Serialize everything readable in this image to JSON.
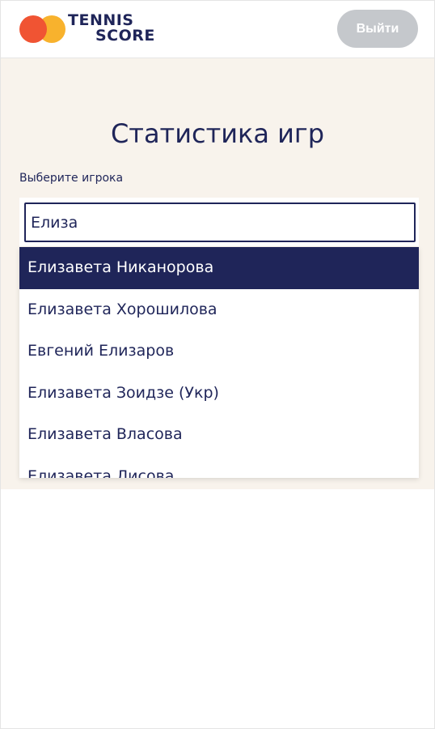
{
  "header": {
    "logo_line1": "TENNIS",
    "logo_line2": "SCORE",
    "logout_label": "Выйти"
  },
  "main": {
    "title": "Статистика игр",
    "player_label": "Выберите игрока",
    "search_value": "Елиза",
    "suggestions": [
      "Елизавета Никанорова",
      "Елизавета Хорошилова",
      "Евгений Елизаров",
      "Елизавета Зоидзе (Укр)",
      "Елизавета Власова",
      "Елизавета Лисова"
    ],
    "selected_index": 0
  },
  "colors": {
    "brand_navy": "#1f2559",
    "logo_red": "#f05433",
    "logo_yellow": "#f8b22d",
    "panel_bg": "#f8f3ec",
    "button_disabled": "#c5c8cc"
  }
}
